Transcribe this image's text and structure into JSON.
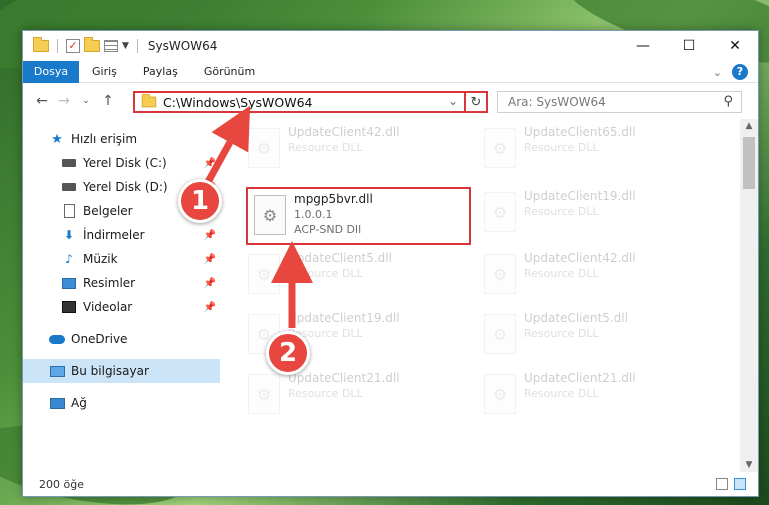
{
  "window": {
    "title": "SysWOW64",
    "controls": {
      "minimize": "—",
      "maximize": "☐",
      "close": "✕"
    }
  },
  "ribbon": {
    "tabs": [
      "Dosya",
      "Giriş",
      "Paylaş",
      "Görünüm"
    ],
    "help": "?"
  },
  "navigation": {
    "address": "C:\\Windows\\SysWOW64",
    "search_placeholder": "Ara: SysWOW64"
  },
  "sidebar": {
    "quick_access": "Hızlı erişim",
    "items": [
      {
        "label": "Yerel Disk (C:)",
        "icon": "drive-icon",
        "pinned": true
      },
      {
        "label": "Yerel Disk (D:)",
        "icon": "drive-icon",
        "pinned": true
      },
      {
        "label": "Belgeler",
        "icon": "documents-icon",
        "pinned": true
      },
      {
        "label": "İndirmeler",
        "icon": "downloads-icon",
        "pinned": true
      },
      {
        "label": "Müzik",
        "icon": "music-icon",
        "pinned": true
      },
      {
        "label": "Resimler",
        "icon": "pictures-icon",
        "pinned": true
      },
      {
        "label": "Videolar",
        "icon": "videos-icon",
        "pinned": true
      }
    ],
    "onedrive": "OneDrive",
    "this_pc": "Bu bilgisayar",
    "network": "Ağ"
  },
  "files": {
    "highlighted": {
      "name": "mpgp5bvr.dll",
      "version": "1.0.0.1",
      "description": "ACP-SND Dll"
    },
    "background": [
      {
        "name": "UpdateClient42.dll",
        "type": "Resource DLL"
      },
      {
        "name": "UpdateClient65.dll",
        "type": "Resource DLL"
      },
      {
        "name": "UpdateClient19.dll",
        "type": "Resource DLL"
      },
      {
        "name": "UpdateClient5.dll",
        "type": "Resource DLL"
      },
      {
        "name": "UpdateClient42.dll",
        "type": "Resource DLL"
      },
      {
        "name": "UpdateClient19.dll",
        "type": "Resource DLL"
      },
      {
        "name": "UpdateClient5.dll",
        "type": "Resource DLL"
      },
      {
        "name": "UpdateClient21.dll",
        "type": "Resource DLL"
      },
      {
        "name": "UpdateClient21.dll",
        "type": "Resource DLL"
      }
    ]
  },
  "status": {
    "item_count": "200 öğe"
  },
  "callouts": [
    "1",
    "2"
  ],
  "colors": {
    "accent": "#1979ca",
    "highlight": "#d9353a",
    "callout": "#e8473f"
  }
}
